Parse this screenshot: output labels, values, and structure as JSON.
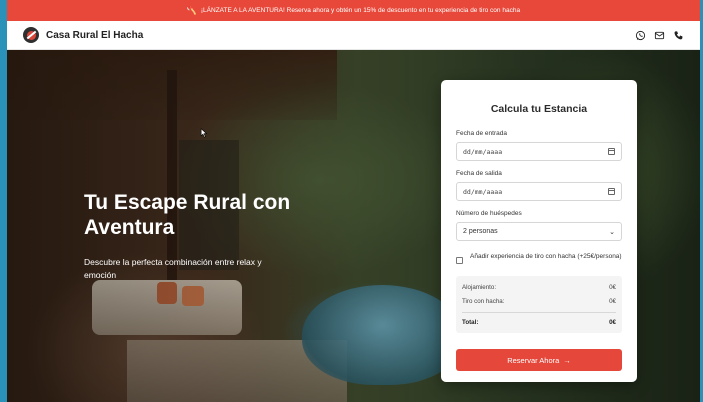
{
  "promo": {
    "icon": "axe-icon",
    "text": "¡LÁNZATE A LA AVENTURA! Reserva ahora y obtén un 15% de descuento en tu experiencia de tiro con hacha"
  },
  "header": {
    "brand": "Casa Rural El Hacha",
    "icons": [
      "whatsapp-icon",
      "mail-icon",
      "phone-icon"
    ]
  },
  "hero": {
    "title": "Tu Escape Rural con Aventura",
    "subtitle": "Descubre la perfecta combinación entre relax y emoción"
  },
  "calculator": {
    "title": "Calcula tu Estancia",
    "checkin_label": "Fecha de entrada",
    "checkin_value": "dd/mm/aaaa",
    "checkout_label": "Fecha de salida",
    "checkout_value": "dd/mm/aaaa",
    "guests_label": "Número de huéspedes",
    "guests_selected": "2 personas",
    "axe_option_label": "Añadir experiencia de tiro con hacha (+25€/persona)",
    "axe_option_checked": false,
    "summary": {
      "lodging_label": "Alojamiento:",
      "lodging_value": "0€",
      "axe_label": "Tiro con hacha:",
      "axe_value": "0€",
      "total_label": "Total:",
      "total_value": "0€"
    },
    "cta_label": "Reservar Ahora"
  },
  "colors": {
    "accent": "#e5473a",
    "promo_bg": "#e8483a"
  }
}
